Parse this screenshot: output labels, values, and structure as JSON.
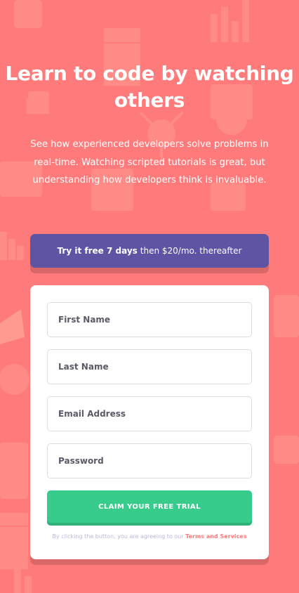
{
  "hero": {
    "title": "Learn to code by watching others",
    "description": "See how experienced developers solve problems in real-time. Watching scripted tutorials is great, but understanding how developers think is invaluable."
  },
  "trial": {
    "bold": "Try it free 7 days",
    "rest": "then $20/mo. thereafter"
  },
  "form": {
    "first_name_placeholder": "First Name",
    "last_name_placeholder": "Last Name",
    "email_placeholder": "Email Address",
    "password_placeholder": "Password",
    "submit_label": "CLAIM YOUR FREE TRIAL",
    "terms_prefix": "By clicking the button, you are agreeing to our",
    "terms_link": "Terms and Services"
  },
  "colors": {
    "background": "#ff7a7a",
    "banner": "#5e54a4",
    "button": "#38cc8c",
    "link": "#ff7a7a"
  }
}
